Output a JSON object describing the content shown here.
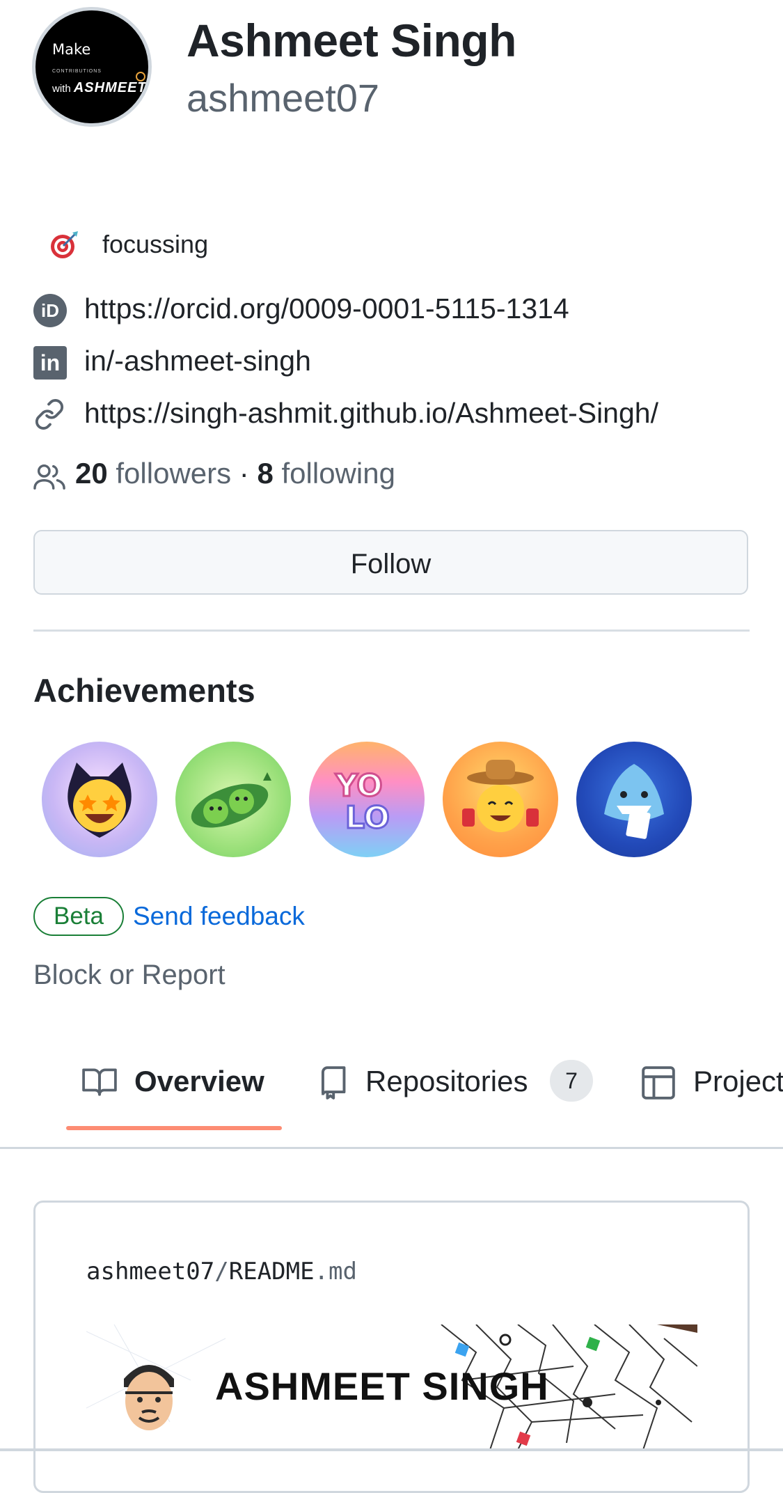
{
  "profile": {
    "full_name": "Ashmeet Singh",
    "username": "ashmeet07",
    "avatar": {
      "line1": "Make",
      "line2": "CONTRIBUTIONS",
      "line3_prefix": "with",
      "line3_name": "ASHMEET"
    }
  },
  "status": {
    "icon": "dart-target-icon",
    "text": "focussing"
  },
  "links": [
    {
      "icon": "orcid-icon",
      "icon_text": "iD",
      "text": "https://orcid.org/0009-0001-5115-1314"
    },
    {
      "icon": "linkedin-icon",
      "icon_text": "in",
      "text": "in/-ashmeet-singh"
    },
    {
      "icon": "link-icon",
      "text": "https://singh-ashmit.github.io/Ashmeet-Singh/"
    }
  ],
  "follow_stats": {
    "followers_count": "20",
    "followers_label": "followers",
    "separator": "·",
    "following_count": "8",
    "following_label": "following"
  },
  "follow_button": "Follow",
  "achievements": {
    "title": "Achievements",
    "badges": [
      "starstruck-badge",
      "pair-extraordinaire-badge",
      "yolo-badge",
      "quickdraw-badge",
      "pull-shark-badge"
    ]
  },
  "beta": {
    "label": "Beta",
    "feedback": "Send feedback"
  },
  "block_report": "Block or Report",
  "tabs": [
    {
      "icon": "book-icon",
      "label": "Overview",
      "active": true
    },
    {
      "icon": "repo-icon",
      "label": "Repositories",
      "count": "7"
    },
    {
      "icon": "table-icon",
      "label": "Projects"
    }
  ],
  "readme": {
    "owner": "ashmeet07",
    "separator": "/",
    "file": "README",
    "ext": ".md",
    "banner_title": "ASHMEET SINGH"
  },
  "colors": {
    "accent_underline": "#fd8c73",
    "link_blue": "#0969da",
    "beta_green": "#1a7f37",
    "muted": "#59636e"
  }
}
